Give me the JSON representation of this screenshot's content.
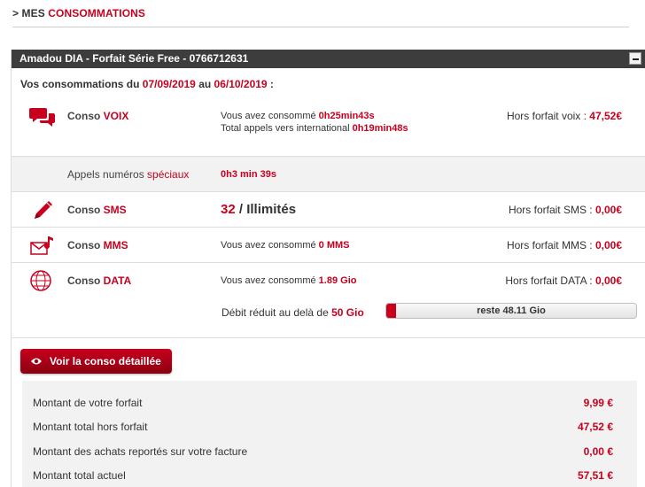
{
  "header": {
    "prefix": "> MES ",
    "title": "CONSOMMATIONS"
  },
  "panel": {
    "title": "Amadou DIA - Forfait Série Free - 0766712631",
    "period_prefix": "Vos consommations du ",
    "period_start": "07/09/2019",
    "period_middle": " au ",
    "period_end": "06/10/2019",
    "period_suffix": " :"
  },
  "voix": {
    "label_prefix": "Conso ",
    "label_kw": "VOIX",
    "line1_prefix": "Vous avez consommé ",
    "line1_value": "0h25min43s",
    "line2_prefix": "Total appels vers international ",
    "line2_value": "0h19min48s",
    "hors_label": "Hors forfait voix : ",
    "hors_value": "47,52€",
    "icon": "chat-bubbles-icon"
  },
  "speciaux": {
    "label_prefix": "Appels numéros ",
    "label_kw": "spéciaux",
    "value": "0h3 min 39s"
  },
  "sms": {
    "label_prefix": "Conso ",
    "label_kw": "SMS",
    "count": "32",
    "count_suffix": " / Illimités",
    "hors_label": "Hors forfait SMS : ",
    "hors_value": "0,00€",
    "icon": "pencil-icon"
  },
  "mms": {
    "label_prefix": "Conso ",
    "label_kw": "MMS",
    "detail_prefix": "Vous avez consommé ",
    "detail_value": "0 MMS",
    "hors_label": "Hors forfait MMS : ",
    "hors_value": "0,00€",
    "icon": "envelope-music-icon"
  },
  "data": {
    "label_prefix": "Conso ",
    "label_kw": "DATA",
    "detail_prefix": "Vous avez consommé ",
    "detail_value": "1.89 Gio",
    "hors_label": "Hors forfait DATA : ",
    "hors_value": "0,00€",
    "icon": "globe-icon",
    "gauge_prefix": "Débit réduit au delà de ",
    "gauge_limit": "50 Gio",
    "gauge_text": "reste 48.11 Gio",
    "gauge_used_fraction": 0.0378
  },
  "detail_button": {
    "label": "Voir la conso détaillée",
    "icon": "eye-icon"
  },
  "summary": [
    {
      "label": "Montant de votre forfait",
      "value": "9,99 €"
    },
    {
      "label": "Montant total hors forfait",
      "value": "47,52 €"
    },
    {
      "label": "Montant des achats reportés sur votre facture",
      "value": "0,00 €"
    },
    {
      "label": "Montant total actuel",
      "value": "57,51 €"
    }
  ],
  "colors": {
    "accent": "#c8001e",
    "title_bar": "#3d3d3d",
    "row_grey": "#f2f2f2"
  }
}
